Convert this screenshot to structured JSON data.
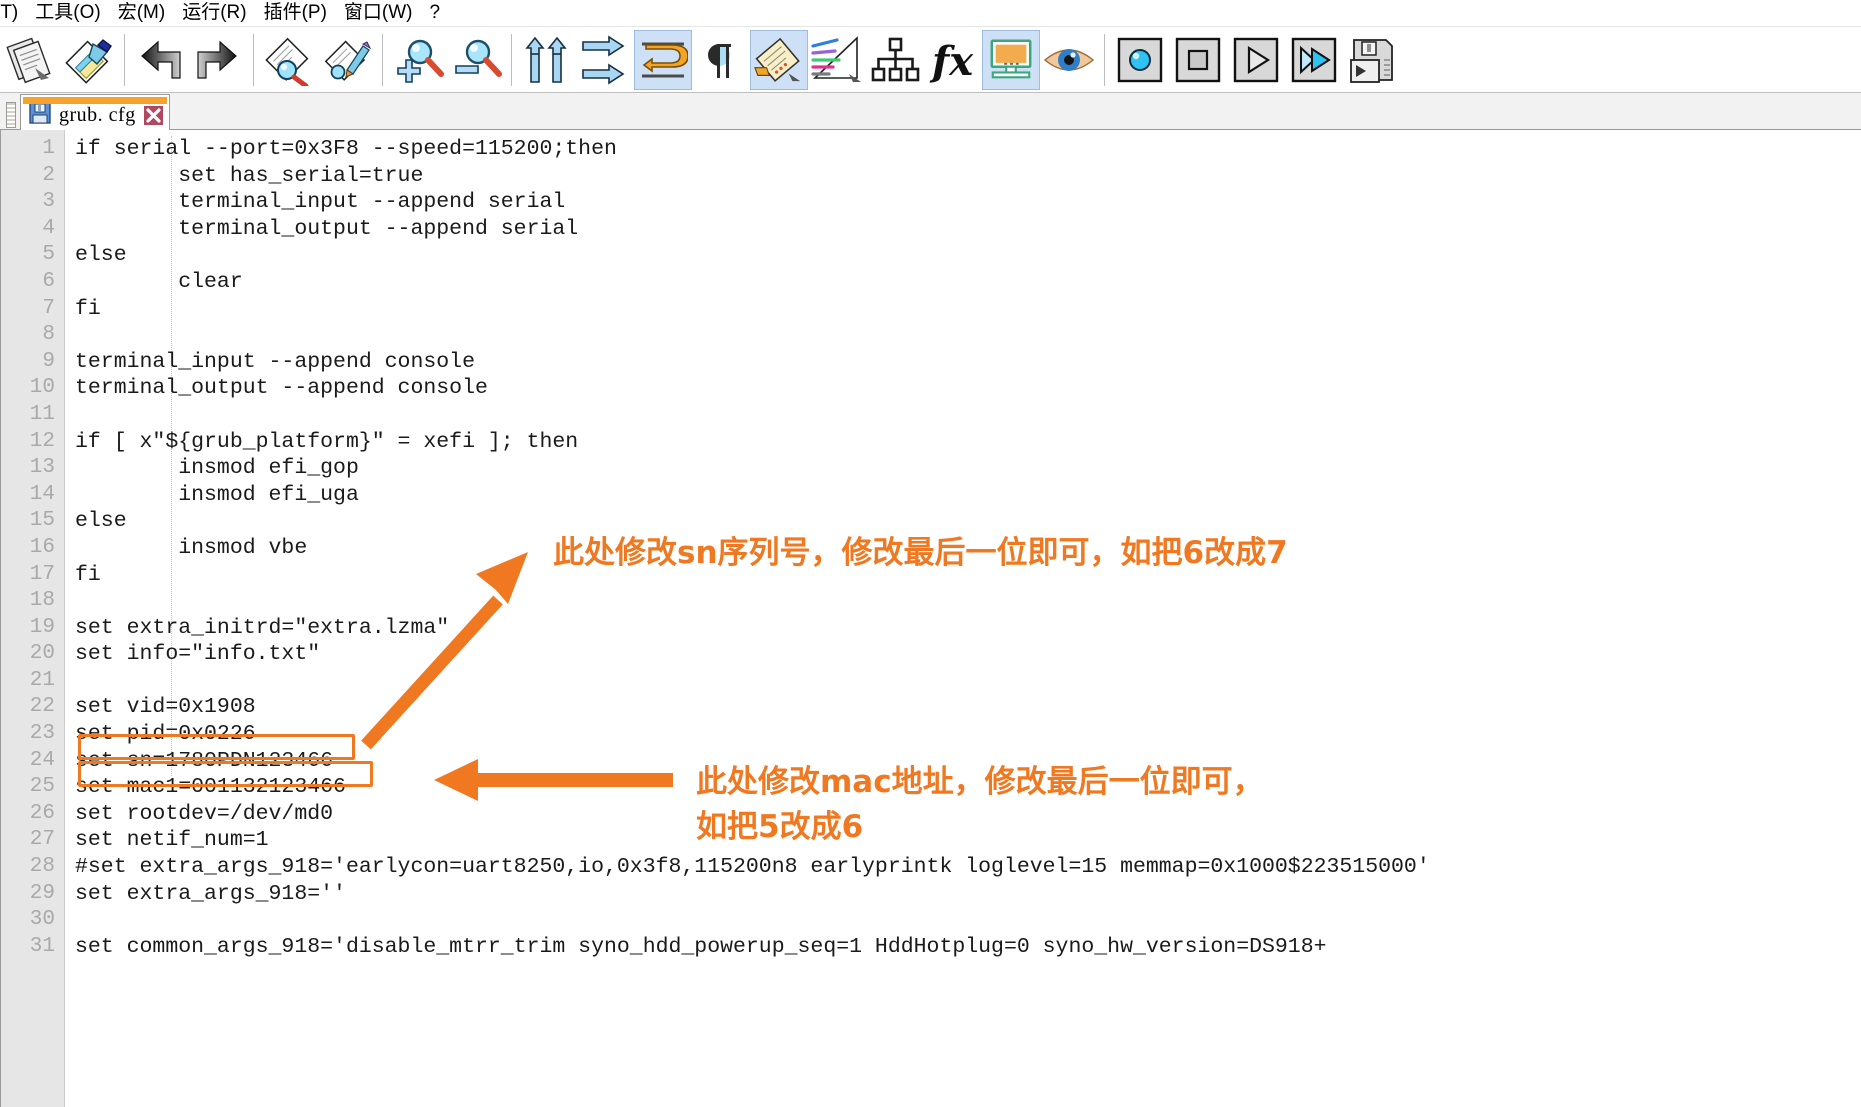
{
  "app": {
    "accent_orange": "#f07820",
    "tab_header_orange": "#f7a22b"
  },
  "menubar": {
    "items": [
      {
        "label": "(T)"
      },
      {
        "label": "工具(O)"
      },
      {
        "label": "宏(M)"
      },
      {
        "label": "运行(R)"
      },
      {
        "label": "插件(P)"
      },
      {
        "label": "窗口(W)"
      },
      {
        "label": "?"
      }
    ]
  },
  "toolbar": {
    "groups": [
      {
        "buttons": [
          {
            "icon": "documents-stack-icon",
            "active": false
          },
          {
            "icon": "paste-brush-icon",
            "active": false
          }
        ]
      },
      {
        "buttons": [
          {
            "icon": "undo-arrow-icon",
            "active": false
          },
          {
            "icon": "redo-arrow-icon",
            "active": false
          }
        ]
      },
      {
        "buttons": [
          {
            "icon": "find-document-icon",
            "active": false
          },
          {
            "icon": "replace-document-icon",
            "active": false
          }
        ]
      },
      {
        "buttons": [
          {
            "icon": "zoom-in-icon",
            "active": false
          },
          {
            "icon": "zoom-out-icon",
            "active": false
          }
        ]
      },
      {
        "buttons": [
          {
            "icon": "compare-up-arrows-icon",
            "active": false
          },
          {
            "icon": "sync-right-arrows-icon",
            "active": false
          },
          {
            "icon": "word-wrap-icon",
            "active": true
          },
          {
            "icon": "pilcrow-icon",
            "active": false
          },
          {
            "icon": "notes-pad-icon",
            "active": true
          },
          {
            "icon": "color-lines-icon",
            "active": false
          },
          {
            "icon": "hierarchy-icon",
            "active": false
          },
          {
            "icon": "function-fx-icon",
            "active": false
          },
          {
            "icon": "monitor-preview-icon",
            "active": true
          },
          {
            "icon": "eye-preview-icon",
            "active": false
          }
        ]
      },
      {
        "buttons": [
          {
            "icon": "record-macro-icon",
            "active": false
          },
          {
            "icon": "stop-macro-icon",
            "active": false
          },
          {
            "icon": "play-macro-icon",
            "active": false
          },
          {
            "icon": "play-all-macro-icon",
            "active": false
          },
          {
            "icon": "save-macro-icon",
            "active": false
          }
        ]
      }
    ]
  },
  "tabs": [
    {
      "label": "grub. cfg",
      "icon": "floppy-save-icon",
      "close_icon": "close-red-x-icon",
      "active": true
    }
  ],
  "editor": {
    "first_line_number": 1,
    "lines": [
      {
        "n": 1,
        "text": "if serial --port=0x3F8 --speed=115200;then"
      },
      {
        "n": 2,
        "text": "        set has_serial=true"
      },
      {
        "n": 3,
        "text": "        terminal_input --append serial"
      },
      {
        "n": 4,
        "text": "        terminal_output --append serial"
      },
      {
        "n": 5,
        "text": "else"
      },
      {
        "n": 6,
        "text": "        clear"
      },
      {
        "n": 7,
        "text": "fi"
      },
      {
        "n": 8,
        "text": ""
      },
      {
        "n": 9,
        "text": "terminal_input --append console"
      },
      {
        "n": 10,
        "text": "terminal_output --append console"
      },
      {
        "n": 11,
        "text": ""
      },
      {
        "n": 12,
        "text": "if [ x\"${grub_platform}\" = xefi ]; then"
      },
      {
        "n": 13,
        "text": "        insmod efi_gop"
      },
      {
        "n": 14,
        "text": "        insmod efi_uga"
      },
      {
        "n": 15,
        "text": "else"
      },
      {
        "n": 16,
        "text": "        insmod vbe"
      },
      {
        "n": 17,
        "text": "fi"
      },
      {
        "n": 18,
        "text": ""
      },
      {
        "n": 19,
        "text": "set extra_initrd=\"extra.lzma\""
      },
      {
        "n": 20,
        "text": "set info=\"info.txt\""
      },
      {
        "n": 21,
        "text": ""
      },
      {
        "n": 22,
        "text": "set vid=0x1908"
      },
      {
        "n": 23,
        "text": "set pid=0x0226"
      },
      {
        "n": 24,
        "text": "set sn=1780PDN123466"
      },
      {
        "n": 25,
        "text": "set mac1=001132123466"
      },
      {
        "n": 26,
        "text": "set rootdev=/dev/md0"
      },
      {
        "n": 27,
        "text": "set netif_num=1"
      },
      {
        "n": 28,
        "text": "#set extra_args_918='earlycon=uart8250,io,0x3f8,115200n8 earlyprintk loglevel=15 memmap=0x1000$223515000'"
      },
      {
        "n": 29,
        "text": "set extra_args_918=''"
      },
      {
        "n": 30,
        "text": ""
      },
      {
        "n": 31,
        "text": "set common_args_918='disable_mtrr_trim syno_hdd_powerup_seq=1 HddHotplug=0 syno_hw_version=DS918+"
      }
    ]
  },
  "annotations": {
    "sn_note": "此处修改sn序列号，修改最后一位即可，如把6改成7",
    "mac_note_line1": "此处修改mac地址，修改最后一位即可，",
    "mac_note_line2": "如把5改成6",
    "highlight_boxes": [
      {
        "target_line": 24,
        "label": "sn-highlight-box"
      },
      {
        "target_line": 25,
        "label": "mac1-highlight-box"
      }
    ],
    "arrows": [
      {
        "label": "sn-arrow",
        "points_to_line": 24
      },
      {
        "label": "mac-arrow",
        "points_to_line": 25
      }
    ]
  }
}
